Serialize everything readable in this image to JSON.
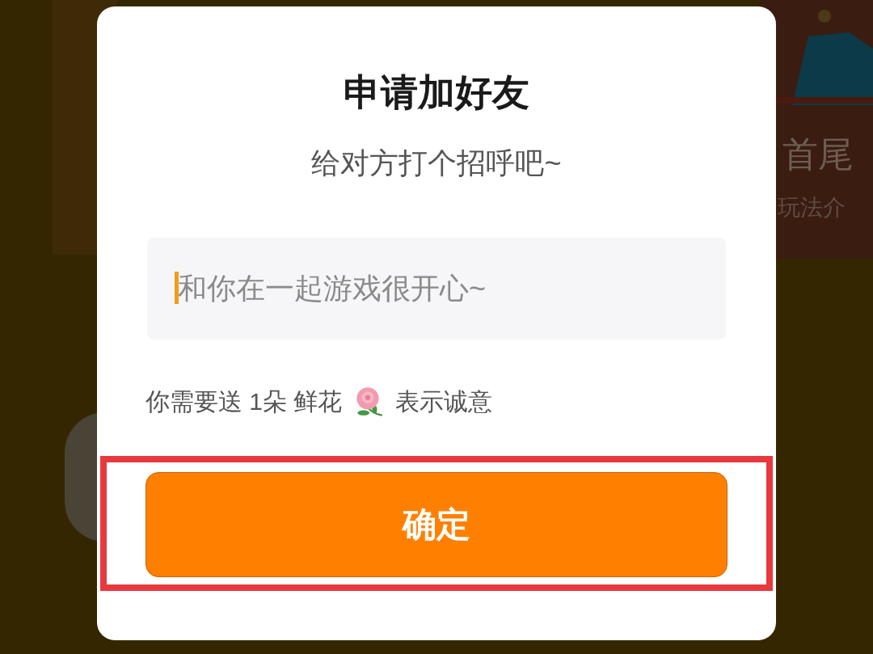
{
  "background": {
    "card_title": "首尾",
    "card_subtitle": "玩法介"
  },
  "dialog": {
    "title": "申请加好友",
    "subtitle": "给对方打个招呼吧~",
    "message_field": {
      "placeholder": "和你在一起游戏很开心~"
    },
    "note_before": "你需要送 1朵 鲜花",
    "note_after": "表示诚意",
    "confirm_button": "确定",
    "highlighted": true
  }
}
